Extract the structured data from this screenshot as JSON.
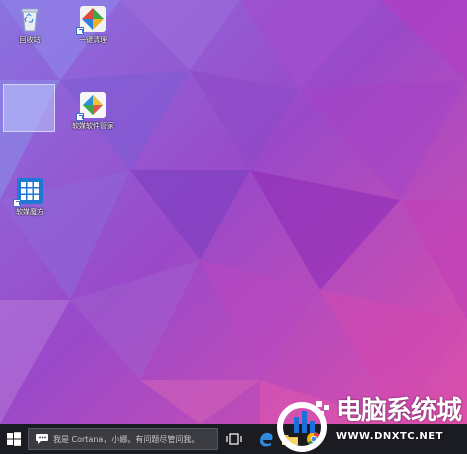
{
  "desktop": {
    "icons": [
      {
        "label": "回收站"
      },
      {
        "label": "一键清理"
      },
      {
        "label": "软媒软件管家"
      },
      {
        "label": "软媒魔方"
      }
    ]
  },
  "taskbar": {
    "search_placeholder": "我是 Cortana，小娜。有问题尽管问我。"
  },
  "watermark": {
    "title": "电脑系统城",
    "url": "WWW.DNXTC.NET"
  },
  "colors": {
    "wallpaper_left": "#7b5fd6",
    "wallpaper_right": "#e04fb0",
    "taskbar": "#1b1b22",
    "brand_blue": "#1a6fd8"
  }
}
